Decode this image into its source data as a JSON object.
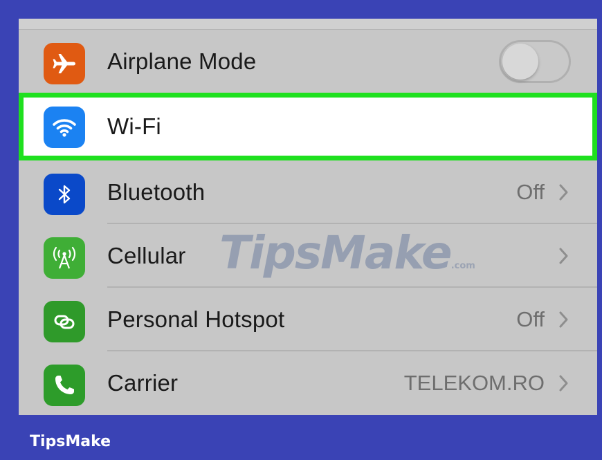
{
  "settings": {
    "rows": [
      {
        "label": "Airplane Mode",
        "icon": "airplane-icon",
        "icon_bg": "#e05a12",
        "control": "toggle",
        "toggle_on": false
      },
      {
        "label": "Wi-Fi",
        "icon": "wifi-icon",
        "icon_bg": "#1b82f2",
        "highlighted": true,
        "highlight_color": "#1fe01f"
      },
      {
        "label": "Bluetooth",
        "icon": "bluetooth-icon",
        "icon_bg": "#0a49c9",
        "value": "Off"
      },
      {
        "label": "Cellular",
        "icon": "cellular-icon",
        "icon_bg": "#3fae36",
        "value": ""
      },
      {
        "label": "Personal Hotspot",
        "icon": "hotspot-icon",
        "icon_bg": "#2f9a2a",
        "value": "Off"
      },
      {
        "label": "Carrier",
        "icon": "phone-icon",
        "icon_bg": "#2d9c2a",
        "value": "TELEKOM.RO"
      }
    ]
  },
  "watermark": {
    "text": "TipsMake",
    "suffix": ".com"
  },
  "brand": {
    "text": "TipsMake"
  },
  "colors": {
    "frame_bg": "#3a43b5",
    "list_bg": "#c7c7c7"
  }
}
